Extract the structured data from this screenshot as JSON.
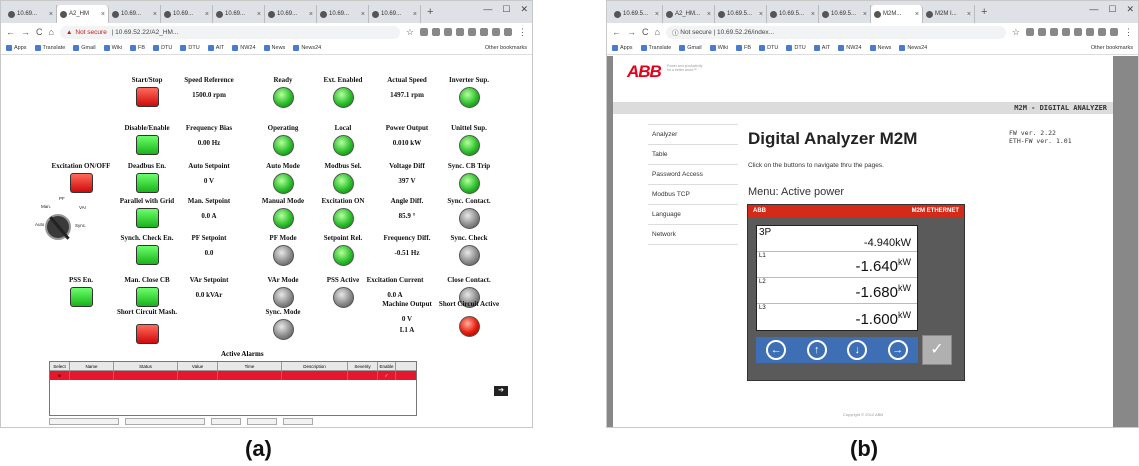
{
  "panel_a": {
    "browser": {
      "tabs": [
        "10.69...",
        "A2_HM",
        "10.69...",
        "10.69...",
        "10.69...",
        "10.69...",
        "10.69...",
        "10.69..."
      ],
      "url_warning": "Not secure",
      "url": "10.69.52.22/A2_HM...",
      "bookmarks": [
        "Apps",
        "Translate",
        "Gmail",
        "Wiki",
        "FB",
        "DTU",
        "DTU",
        "AIT",
        "NW24",
        "News",
        "News24"
      ],
      "other_bookmarks": "Other bookmarks"
    },
    "labels": {
      "start_stop": "Start/Stop",
      "disable_enable": "Disable/Enable",
      "excitation_onoff": "Excitation ON/OFF",
      "deadbus_en": "Deadbus En.",
      "parallel_grid": "Parallel with Grid",
      "synch_check_en": "Synch. Check En.",
      "pss_en": "PSS En.",
      "man_close_cb": "Man. Close CB",
      "short_circuit_mash": "Short Circuit Mash.",
      "speed_reference": "Speed Reference",
      "frequency_bias": "Frequency Bias",
      "auto_setpoint": "Auto Setpoint",
      "man_setpoint": "Man. Setpoint",
      "pf_setpoint": "PF Setpoint",
      "var_setpoint": "VAr Setpoint"
    },
    "values": {
      "speed_reference": "1500.0 rpm",
      "frequency_bias": "0.00 Hz",
      "auto_setpoint": "0 V",
      "man_setpoint": "0.0 A",
      "pf_setpoint": "0.0",
      "var_setpoint": "0.0 kVAr",
      "actual_speed": "1497.1 rpm",
      "power_output": "0.010 kW",
      "voltage_diff": "397 V",
      "angle_diff": "85.9 °",
      "frequency_diff": "-0.51 Hz",
      "excitation_current": "0.0 A",
      "machine_output_v": "0 V",
      "machine_output_a": "L1 A"
    },
    "indicators": [
      {
        "label": "Ready",
        "state": "green"
      },
      {
        "label": "Ext. Enabled",
        "state": "green"
      },
      {
        "label": "Inverter Sup.",
        "state": "green"
      },
      {
        "label": "Operating",
        "state": "green"
      },
      {
        "label": "Local",
        "state": "green"
      },
      {
        "label": "Unittel Sup.",
        "state": "green"
      },
      {
        "label": "Auto Mode",
        "state": "green"
      },
      {
        "label": "Modbus Sel.",
        "state": "green"
      },
      {
        "label": "Sync. CB Trip",
        "state": "green"
      },
      {
        "label": "Manual Mode",
        "state": "green"
      },
      {
        "label": "Excitation ON",
        "state": "green"
      },
      {
        "label": "Sync. Contact.",
        "state": "grey"
      },
      {
        "label": "PF Mode",
        "state": "grey"
      },
      {
        "label": "Setpoint Rel.",
        "state": "green"
      },
      {
        "label": "Sync. Check",
        "state": "grey"
      },
      {
        "label": "VAr Mode",
        "state": "grey"
      },
      {
        "label": "PSS Active",
        "state": "grey"
      },
      {
        "label": "Close Contact.",
        "state": "grey"
      },
      {
        "label": "Sync. Mode",
        "state": "grey"
      },
      {
        "label": "Short Circuit Active",
        "state": "red"
      }
    ],
    "measure_labels": {
      "actual_speed": "Actual Speed",
      "power_output": "Power Output",
      "voltage_diff": "Voltage Diff",
      "angle_diff": "Angle Diff.",
      "frequency_diff": "Frequency Diff.",
      "excitation_current": "Excitation Current",
      "machine_output": "Machine Output"
    },
    "knob_labels": [
      "Man.",
      "PF",
      "VAr",
      "Auto",
      "Sync."
    ],
    "alarms": {
      "title": "Active Alarms",
      "columns": [
        "Select",
        "Name",
        "Status",
        "Value",
        "Time",
        "Description",
        "Severity",
        "Enable"
      ],
      "rows": [
        [
          "",
          "",
          "",
          "",
          "",
          "",
          "",
          ""
        ]
      ],
      "bottom_buttons": [
        "",
        "",
        "",
        "",
        ""
      ]
    },
    "caption": "(a)"
  },
  "panel_b": {
    "browser": {
      "tabs": [
        "10.69.5...",
        "A2_HM...",
        "10.69.5...",
        "10.69.5...",
        "10.69.5...",
        "M2M...",
        "M2M I..."
      ],
      "url_warning": "Not secure",
      "url": "10.69.52.26/index...",
      "bookmarks": [
        "Apps",
        "Translate",
        "Gmail",
        "Wiki",
        "FB",
        "DTU",
        "DTU",
        "AIT",
        "NW24",
        "News",
        "News24"
      ],
      "other_bookmarks": "Other bookmarks"
    },
    "brand": "ABB",
    "brand_tagline": "Power and productivity for a better world™",
    "band_title": "M2M - DIGITAL ANALYZER",
    "menu": [
      "Analyzer",
      "Table",
      "Password Access",
      "Modbus TCP",
      "Language",
      "Network"
    ],
    "heading": "Digital Analyzer M2M",
    "fw_ver": "FW ver. 2.22",
    "eth_fw_ver": "ETH-FW ver. 1.01",
    "intro": "Click on the buttons to navigate thru the pages.",
    "menu_label": "Menu: Active power",
    "device": {
      "brand": "ABB",
      "model": "M2M ETHERNET",
      "rows": [
        {
          "phase": "3P",
          "value": "-4.940",
          "unit": "kW"
        },
        {
          "phase": "L1",
          "value": "-1.640",
          "unit": "kW"
        },
        {
          "phase": "L2",
          "value": "-1.680",
          "unit": "kW"
        },
        {
          "phase": "L3",
          "value": "-1.600",
          "unit": "kW"
        }
      ],
      "keys": [
        "←",
        "↑",
        "↓",
        "→"
      ],
      "ok": "✓"
    },
    "copyright": "Copyright © 2012 ABB",
    "caption": "(b)"
  }
}
